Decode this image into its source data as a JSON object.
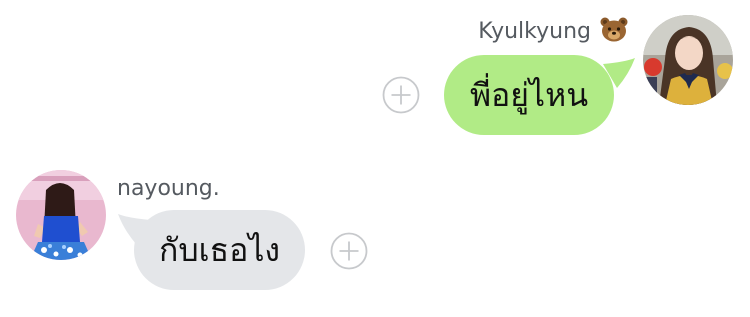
{
  "messages": [
    {
      "side": "right",
      "sender": "Kyulkyung",
      "sender_icon": "bear-face-icon",
      "text": "พี่อยู่ไหน",
      "bubble_color": "#b1eb86"
    },
    {
      "side": "left",
      "sender": "nayoung.",
      "text": "กับเธอไง",
      "bubble_color": "#e4e6e9"
    }
  ],
  "icons": {
    "add_reaction": "plus-circle-icon"
  }
}
